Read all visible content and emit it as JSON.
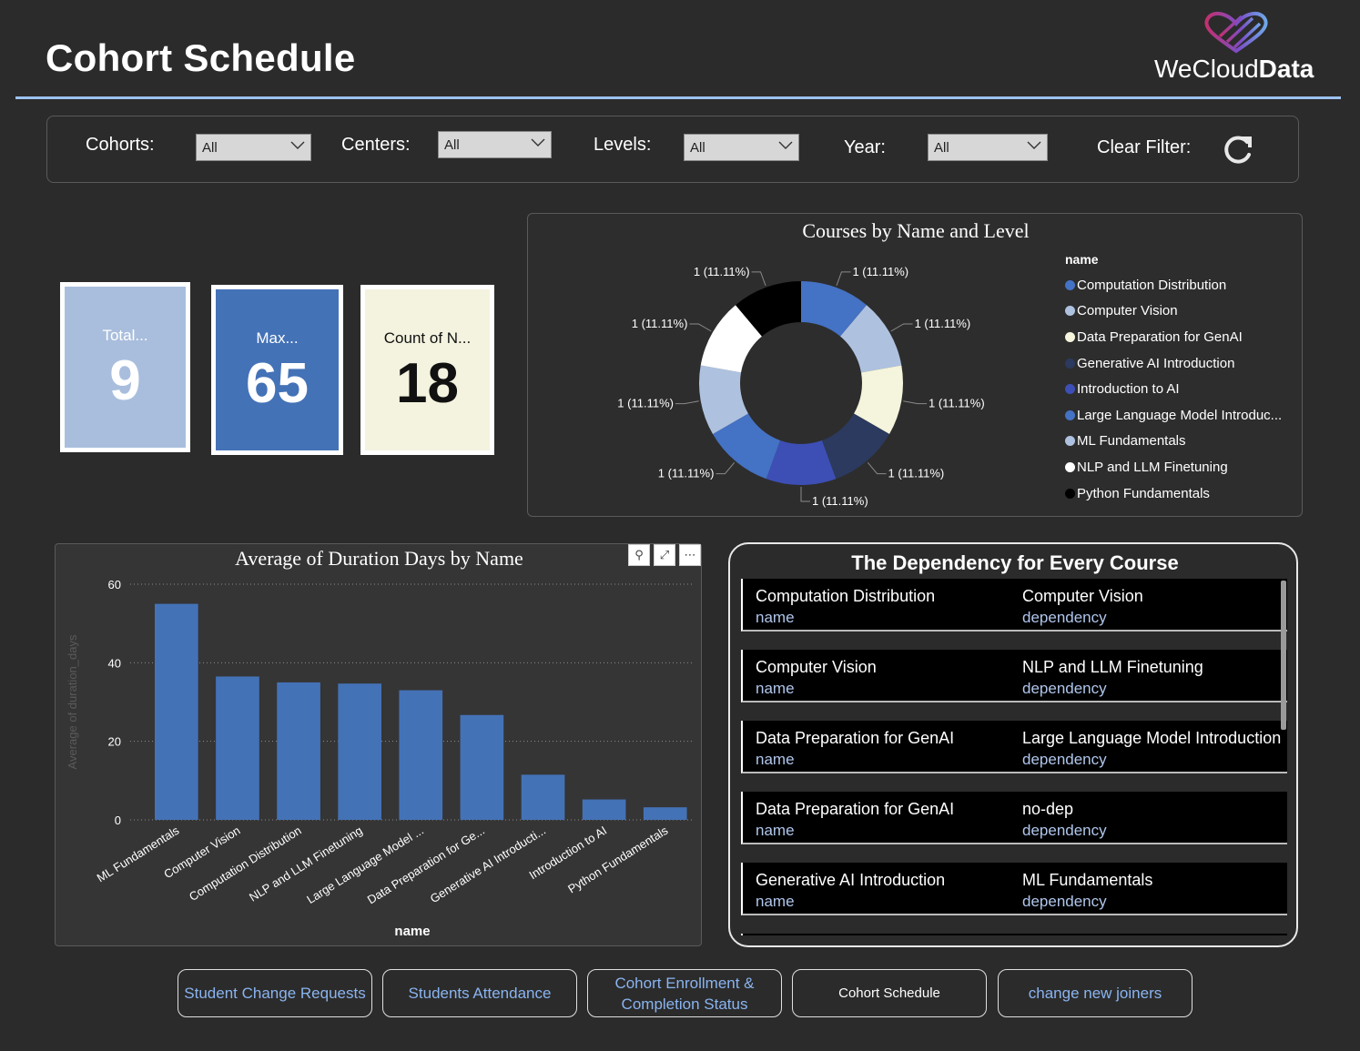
{
  "header": {
    "title": "Cohort Schedule",
    "logo_text_light": "WeCloud",
    "logo_text_bold": "Data"
  },
  "filters": {
    "cohorts": {
      "label": "Cohorts:",
      "value": "All"
    },
    "centers": {
      "label": "Centers:",
      "value": "All"
    },
    "levels": {
      "label": "Levels:",
      "value": "All"
    },
    "year": {
      "label": "Year:",
      "value": "All"
    },
    "clear_label": "Clear Filter:"
  },
  "cards": {
    "total": {
      "caption": "Total...",
      "value": "9"
    },
    "max": {
      "caption": "Max...",
      "value": "65"
    },
    "count": {
      "caption": "Count of N...",
      "value": "18"
    }
  },
  "colors": {
    "background": "#2b2b2b",
    "accent": "#4472b7",
    "header_rule": "#9cc2f0",
    "card_total": "#a9bedd",
    "card_max": "#4472b7",
    "card_count": "#f4f3df",
    "link_text": "#8ab4f0"
  },
  "donut": {
    "title": "Courses by Name and Level",
    "legend_title": "name",
    "chart_data": {
      "type": "pie",
      "title": "Courses by Name and Level",
      "legend_title": "name",
      "legend_position": "right",
      "slices": [
        {
          "name": "Computation Distribution",
          "value": 1,
          "label": "1 (11.11%)",
          "color": "#4472c4"
        },
        {
          "name": "Computer Vision",
          "value": 1,
          "label": "1 (11.11%)",
          "color": "#aec2e0"
        },
        {
          "name": "Data Preparation for GenAI",
          "value": 1,
          "label": "1 (11.11%)",
          "color": "#f5f4dc"
        },
        {
          "name": "Generative AI Introduction",
          "value": 1,
          "label": "1 (11.11%)",
          "color": "#2b3a5e"
        },
        {
          "name": "Introduction to AI",
          "value": 1,
          "label": "1 (11.11%)",
          "color": "#3d4fb5"
        },
        {
          "name": "Large Language Model Introduc...",
          "value": 1,
          "label": "1 (11.11%)",
          "color": "#4472c4"
        },
        {
          "name": "ML Fundamentals",
          "value": 1,
          "label": "1 (11.11%)",
          "color": "#aec2e0"
        },
        {
          "name": "NLP and LLM Finetuning",
          "value": 1,
          "label": "1 (11.11%)",
          "color": "#ffffff"
        },
        {
          "name": "Python Fundamentals",
          "value": 1,
          "label": "1 (11.11%)",
          "color": "#000000"
        }
      ]
    }
  },
  "bar": {
    "title": "Average of Duration Days by Name",
    "tools": [
      "⚲",
      "⤢",
      "⋯"
    ],
    "chart_data": {
      "type": "bar",
      "title": "Average of Duration Days by Name",
      "xlabel": "name",
      "ylabel": "Average of duration_days",
      "ylim": [
        0,
        60
      ],
      "yticks": [
        0,
        20,
        40,
        60
      ],
      "grid": true,
      "color": "#4472b7",
      "categories": [
        "ML Fundamentals",
        "Computer Vision",
        "Computation Distribution",
        "NLP and LLM Finetuning",
        "Large Language Model ...",
        "Data Preparation for Ge...",
        "Generative AI Introducti...",
        "Introduction to AI",
        "Python Fundamentals"
      ],
      "values": [
        55,
        36.5,
        35,
        34.7,
        33,
        26.7,
        11.5,
        5.2,
        3.2
      ]
    }
  },
  "dependency": {
    "title": "The Dependency for Every Course",
    "name_label": "name",
    "dep_label": "dependency",
    "rows": [
      {
        "name": "Computation Distribution",
        "dependency": "Computer Vision"
      },
      {
        "name": "Computer Vision",
        "dependency": "NLP and LLM Finetuning"
      },
      {
        "name": "Data Preparation for GenAI",
        "dependency": "Large Language Model Introduction"
      },
      {
        "name": "Data Preparation for GenAI",
        "dependency": "no-dep"
      },
      {
        "name": "Generative AI Introduction",
        "dependency": "ML Fundamentals"
      }
    ]
  },
  "nav": [
    {
      "label": "Student Change Requests",
      "active": false
    },
    {
      "label": "Students Attendance",
      "active": false
    },
    {
      "label": "Cohort Enrollment & Completion Status",
      "active": false
    },
    {
      "label": "Cohort Schedule",
      "active": true
    },
    {
      "label": "change new joiners",
      "active": false
    }
  ]
}
